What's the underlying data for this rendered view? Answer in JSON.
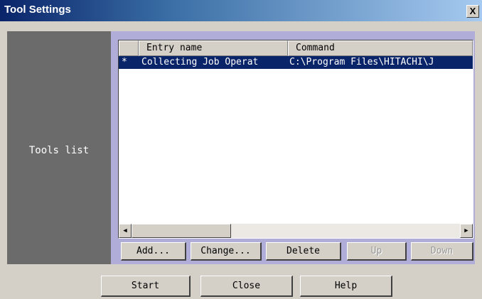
{
  "window": {
    "title": "Tool Settings",
    "close_label": "X"
  },
  "tools": {
    "label": "Tools list",
    "columns": [
      "",
      "Entry name",
      "Command"
    ],
    "rows": [
      {
        "marker": "*",
        "entry_name": "Collecting Job Operat",
        "command": "C:\\Program Files\\HITACHI\\J",
        "selected": true
      }
    ]
  },
  "list_buttons": {
    "add": "Add...",
    "change": "Change...",
    "delete": "Delete",
    "up": "Up",
    "down": "Down"
  },
  "bottom_buttons": {
    "start": "Start",
    "close": "Close",
    "help": "Help"
  },
  "icons": {
    "scroll_left": "arrow-left-icon",
    "scroll_right": "arrow-right-icon"
  },
  "colors": {
    "title_start": "#0a246a",
    "title_end": "#a6caf0",
    "panel_bg": "#b0aed8",
    "label_bg": "#6b6b6b",
    "selection": "#0a246a"
  }
}
